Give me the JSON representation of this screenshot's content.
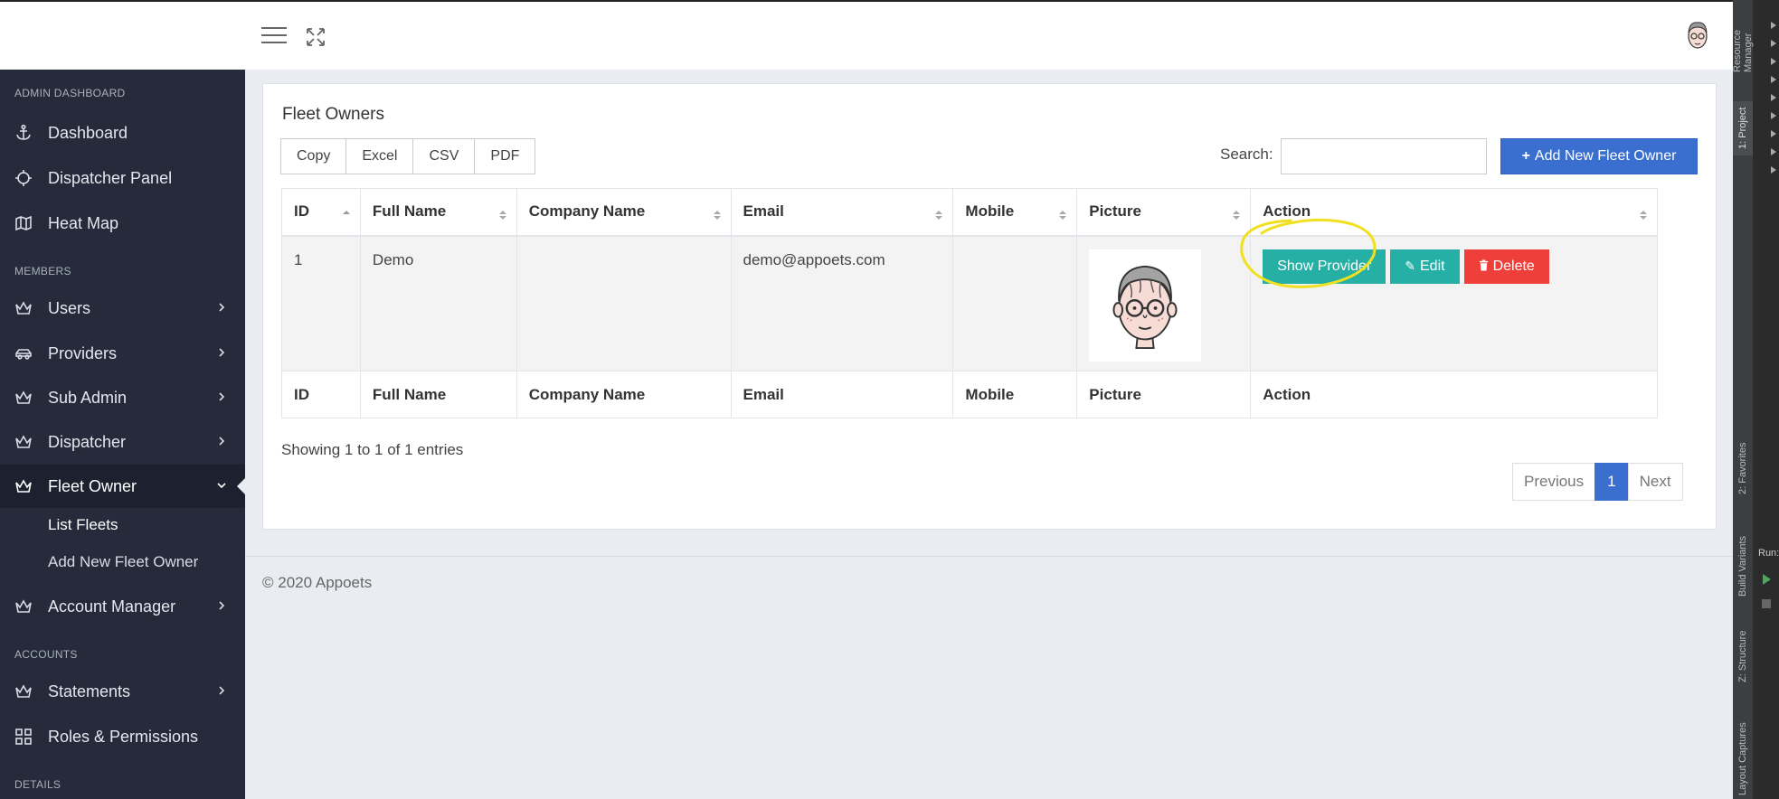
{
  "sidebar": {
    "sections": {
      "admin": "ADMIN DASHBOARD",
      "members": "MEMBERS",
      "accounts": "ACCOUNTS",
      "details": "DETAILS"
    },
    "items": {
      "dashboard": "Dashboard",
      "dispatcher_panel": "Dispatcher Panel",
      "heat_map": "Heat Map",
      "users": "Users",
      "providers": "Providers",
      "sub_admin": "Sub Admin",
      "dispatcher": "Dispatcher",
      "fleet_owner": "Fleet Owner",
      "account_manager": "Account Manager",
      "statements": "Statements",
      "roles_permissions": "Roles & Permissions"
    },
    "fleet_sub": {
      "list_fleets": "List Fleets",
      "add_new": "Add New Fleet Owner"
    }
  },
  "main": {
    "title": "Fleet Owners",
    "export_buttons": [
      "Copy",
      "Excel",
      "CSV",
      "PDF"
    ],
    "search_label": "Search:",
    "search_value": "",
    "add_button": "Add New Fleet Owner",
    "columns": [
      "ID",
      "Full Name",
      "Company Name",
      "Email",
      "Mobile",
      "Picture",
      "Action"
    ],
    "rows": [
      {
        "id": "1",
        "full_name": "Demo",
        "company_name": "",
        "email": "demo@appoets.com",
        "mobile": ""
      }
    ],
    "actions": {
      "show_provider": "Show Provider",
      "edit": "Edit",
      "delete": "Delete"
    },
    "info": "Showing 1 to 1 of 1 entries",
    "pager": {
      "previous": "Previous",
      "current": "1",
      "next": "Next"
    }
  },
  "footer": "© 2020 Appoets",
  "ide": {
    "tabs": [
      "Resource Manager",
      "1: Project",
      "2: Favorites",
      "Build Variants",
      "Z: Structure",
      "Layout Captures"
    ],
    "run_label": "Run:"
  },
  "colors": {
    "sidebar": "#252b3b",
    "primary": "#3a6fd0",
    "teal": "#26b0a5",
    "danger": "#ef3f3a",
    "annotation": "#f0e020"
  },
  "icons": [
    "menu-icon",
    "fullscreen-icon",
    "avatar-icon",
    "anchor-icon",
    "crosshair-icon",
    "map-icon",
    "crown-icon",
    "car-icon",
    "grid-icon",
    "plus-icon",
    "pencil-icon",
    "trash-icon",
    "sort-icon"
  ]
}
